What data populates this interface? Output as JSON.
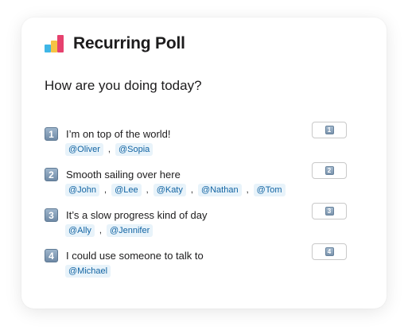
{
  "app": {
    "title": "Recurring Poll"
  },
  "poll": {
    "question": "How are you doing today?",
    "options": [
      {
        "number": "1",
        "label": "I’m on top of the world!",
        "voters": [
          "@Oliver",
          "@Sopia"
        ],
        "button_number": "1"
      },
      {
        "number": "2",
        "label": "Smooth sailing over here",
        "voters": [
          "@John",
          "@Lee",
          "@Katy",
          "@Nathan",
          "@Tom"
        ],
        "button_number": "2"
      },
      {
        "number": "3",
        "label": "It’s a slow progress kind of day",
        "voters": [
          "@Ally",
          "@Jennifer"
        ],
        "button_number": "3"
      },
      {
        "number": "4",
        "label": "I could use someone to talk to",
        "voters": [
          "@Michael"
        ],
        "button_number": "4"
      }
    ]
  },
  "colors": {
    "logo_blue": "#3fb6e6",
    "logo_yellow": "#f6c344",
    "logo_red": "#e6416e",
    "mention_bg": "#e8f3fa",
    "mention_text": "#1264a3"
  }
}
